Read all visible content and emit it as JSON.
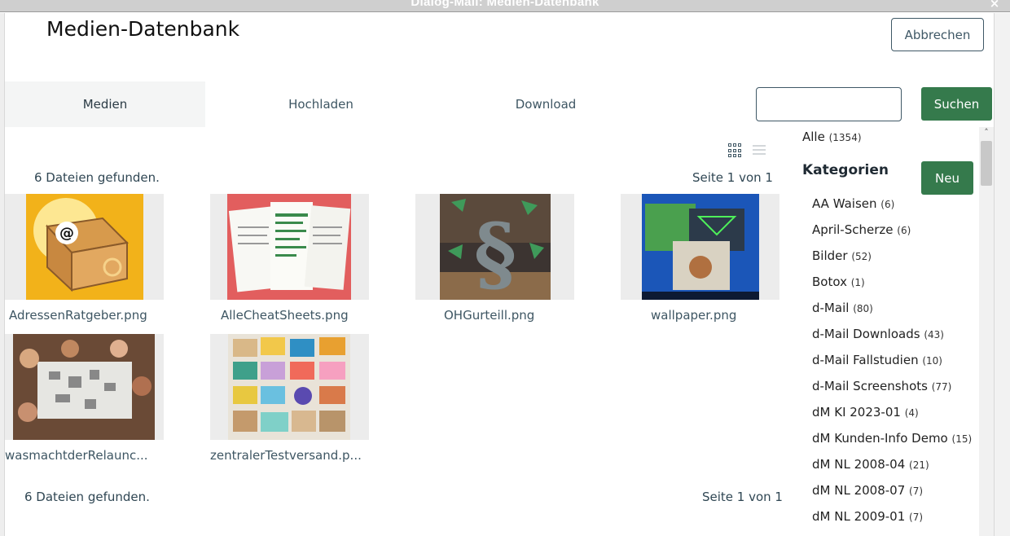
{
  "window": {
    "title": "Dialog-Mail: Medien-Datenbank",
    "close_label": "×"
  },
  "header": {
    "title": "Medien-Datenbank",
    "cancel_label": "Abbrechen"
  },
  "tabs": [
    {
      "label": "Medien",
      "active": true
    },
    {
      "label": "Hochladen",
      "active": false
    },
    {
      "label": "Download",
      "active": false
    }
  ],
  "search": {
    "value": "",
    "button_label": "Suchen"
  },
  "view_toggle": {
    "grid_icon": "grid-icon",
    "list_icon": "list-icon",
    "active": "grid"
  },
  "results": {
    "count_text": "6 Dateien gefunden.",
    "page_text": "Seite 1 von 1"
  },
  "files": [
    {
      "name": "AdressenRatgeber.png",
      "thumb_icon": "golden-chest-at-sign"
    },
    {
      "name": "AlleCheatSheets.png",
      "thumb_icon": "cheat-sheet-documents"
    },
    {
      "name": "OHGurteill.png",
      "thumb_icon": "paragraph-symbol"
    },
    {
      "name": "wallpaper.png",
      "thumb_icon": "desktop-wallpaper"
    },
    {
      "name": "wasmachtderRelaunc...",
      "thumb_icon": "team-meeting"
    },
    {
      "name": "zentralerTestversand.p...",
      "thumb_icon": "envelopes-collage"
    }
  ],
  "categories": {
    "all_label": "Alle",
    "all_count": "(1354)",
    "title": "Kategorien",
    "new_label": "Neu",
    "items": [
      {
        "label": "AA Waisen",
        "count": "(6)"
      },
      {
        "label": "April-Scherze",
        "count": "(6)"
      },
      {
        "label": "Bilder",
        "count": "(52)"
      },
      {
        "label": "Botox",
        "count": "(1)"
      },
      {
        "label": "d-Mail",
        "count": "(80)"
      },
      {
        "label": "d-Mail Downloads",
        "count": "(43)"
      },
      {
        "label": "d-Mail Fallstudien",
        "count": "(10)"
      },
      {
        "label": "d-Mail Screenshots",
        "count": "(77)"
      },
      {
        "label": "dM KI 2023-01",
        "count": "(4)"
      },
      {
        "label": "dM Kunden-Info Demo",
        "count": "(15)"
      },
      {
        "label": "dM NL 2008-04",
        "count": "(21)"
      },
      {
        "label": "dM NL 2008-07",
        "count": "(7)"
      },
      {
        "label": "dM NL 2009-01",
        "count": "(7)"
      }
    ]
  },
  "colors": {
    "accent": "#357a4c",
    "outline": "#3f5866",
    "text_muted": "#3e5663"
  }
}
